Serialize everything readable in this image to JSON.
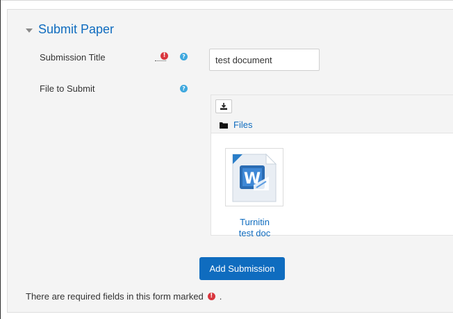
{
  "section": {
    "title": "Submit Paper"
  },
  "form": {
    "submission_title_label": "Submission Title",
    "submission_title_value": "test document",
    "file_label": "File to Submit"
  },
  "filepicker": {
    "path_folder": "Files",
    "file": {
      "name": "Turnitin",
      "second_line": "test doc"
    }
  },
  "actions": {
    "submit_label": "Add Submission"
  },
  "footer": {
    "required_note": "There are required fields in this form marked",
    "period": "."
  },
  "icons": {
    "required": "exclamation-circle-icon",
    "help": "question-circle-icon",
    "upload": "download-tray-icon",
    "folder": "folder-icon",
    "file": "word-document-icon"
  },
  "colors": {
    "accent": "#0f6cbf",
    "required": "#d9363e",
    "help": "#3fa8de"
  }
}
